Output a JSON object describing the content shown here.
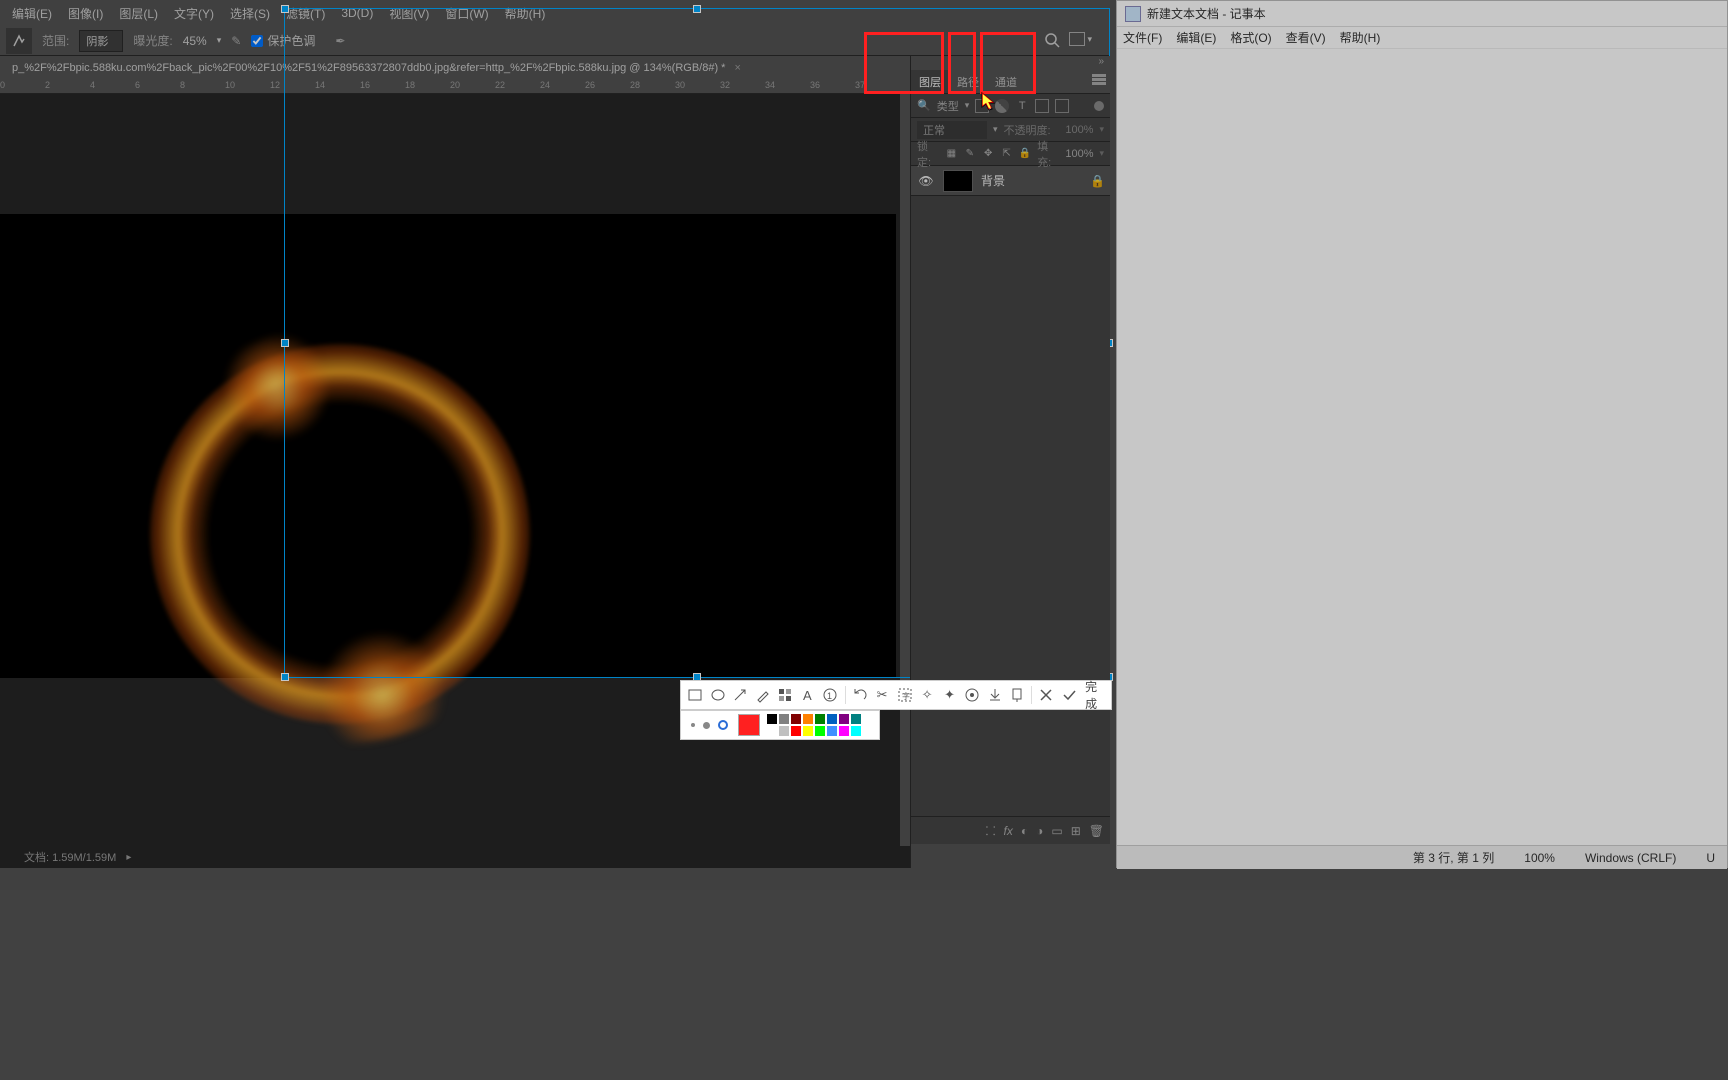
{
  "menubar": {
    "edit": "编辑(E)",
    "image": "图像(I)",
    "layer": "图层(L)",
    "type": "文字(Y)",
    "select": "选择(S)",
    "filter": "滤镜(T)",
    "threeD": "3D(D)",
    "view": "视图(V)",
    "window": "窗口(W)",
    "help": "帮助(H)"
  },
  "options": {
    "range_label": "范围:",
    "range_value": "阴影",
    "exposure_label": "曝光度:",
    "exposure_value": "45%",
    "protect_tones": "保护色调"
  },
  "doc_tab": {
    "title": "p_%2F%2Fbpic.588ku.com%2Fback_pic%2F00%2F10%2F51%2F89563372807ddb0.jpg&refer=http_%2F%2Fbpic.588ku.jpg @ 134%(RGB/8#) *"
  },
  "ruler_ticks": [
    "0",
    "2",
    "4",
    "6",
    "8",
    "10",
    "12",
    "14",
    "16",
    "18",
    "20",
    "22",
    "24",
    "26",
    "28",
    "30",
    "32",
    "34",
    "36",
    "37"
  ],
  "panels": {
    "tab_layers": "图层",
    "tab_paths": "路径",
    "tab_channels": "通道",
    "filter_label": "类型",
    "blend_mode": "正常",
    "opacity_label": "不透明度:",
    "opacity_value": "100%",
    "lock_label": "锁定:",
    "fill_label": "填充:",
    "fill_value": "100%",
    "layer_bg": "背景"
  },
  "status": {
    "docsize": "文档: 1.59M/1.59M"
  },
  "notepad": {
    "title": "新建文本文档 - 记事本",
    "file": "文件(F)",
    "edit": "编辑(E)",
    "format": "格式(O)",
    "view": "查看(V)",
    "help": "帮助(H)",
    "status_pos": "第 3 行, 第 1 列",
    "status_zoom": "100%",
    "status_enc": "Windows (CRLF)",
    "status_utf": "U"
  },
  "annot": {
    "done": "完成"
  },
  "palette": {
    "current": "#ff2020",
    "colors_top": [
      "#000000",
      "#808080",
      "#800000",
      "#ff8000",
      "#008000",
      "#0060c0",
      "#800080",
      "#008080"
    ],
    "colors_bottom": [
      "#ffffff",
      "#c0c0c0",
      "#ff0000",
      "#ffff00",
      "#00ff00",
      "#4090ff",
      "#ff00ff",
      "#00ffff"
    ]
  }
}
